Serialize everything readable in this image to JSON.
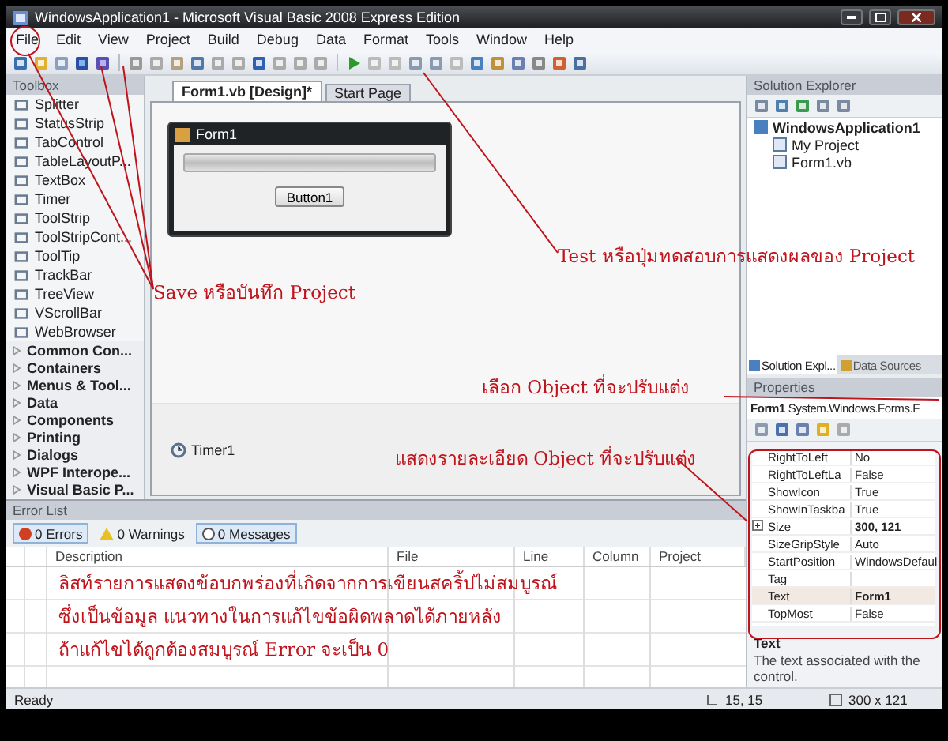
{
  "window": {
    "title": "WindowsApplication1 - Microsoft Visual Basic 2008 Express Edition"
  },
  "menu": [
    "File",
    "Edit",
    "View",
    "Project",
    "Build",
    "Debug",
    "Data",
    "Format",
    "Tools",
    "Window",
    "Help"
  ],
  "toolbox": {
    "title": "Toolbox",
    "items": [
      {
        "label": "Splitter"
      },
      {
        "label": "StatusStrip"
      },
      {
        "label": "TabControl"
      },
      {
        "label": "TableLayoutP..."
      },
      {
        "label": "TextBox"
      },
      {
        "label": "Timer"
      },
      {
        "label": "ToolStrip"
      },
      {
        "label": "ToolStripCont..."
      },
      {
        "label": "ToolTip"
      },
      {
        "label": "TrackBar"
      },
      {
        "label": "TreeView"
      },
      {
        "label": "VScrollBar"
      },
      {
        "label": "WebBrowser"
      }
    ],
    "categories": [
      {
        "label": "Common Con...",
        "expanded": false
      },
      {
        "label": "Containers",
        "expanded": false
      },
      {
        "label": "Menus & Tool...",
        "expanded": false
      },
      {
        "label": "Data",
        "expanded": false
      },
      {
        "label": "Components",
        "expanded": false
      },
      {
        "label": "Printing",
        "expanded": false
      },
      {
        "label": "Dialogs",
        "expanded": false
      },
      {
        "label": "WPF Interope...",
        "expanded": false
      },
      {
        "label": "Visual Basic P...",
        "expanded": false
      }
    ]
  },
  "document_tabs": [
    {
      "label": "Form1.vb [Design]*",
      "selected": true
    },
    {
      "label": "Start Page",
      "selected": false
    }
  ],
  "designer": {
    "form_title": "Form1",
    "progress": {
      "level": 0
    },
    "button": "Button1",
    "component": "Timer1"
  },
  "solution_explorer": {
    "title": "Solution Explorer",
    "tree": [
      {
        "label": "WindowsApplication1",
        "children": [
          {
            "label": "My Project"
          },
          {
            "label": "Form1.vb"
          }
        ]
      }
    ],
    "tabs": [
      {
        "label": "Solution Expl...",
        "selected": true
      },
      {
        "label": "Data Sources",
        "selected": false
      }
    ]
  },
  "properties": {
    "title": "Properties",
    "object": "Form1",
    "type": "System.Windows.Forms.F",
    "rows": [
      {
        "name": "RightToLeft",
        "value": "No",
        "modified": false,
        "selected": false
      },
      {
        "name": "RightToLeftLa",
        "value": "False",
        "modified": false,
        "selected": false
      },
      {
        "name": "ShowIcon",
        "value": "True",
        "modified": false,
        "selected": false
      },
      {
        "name": "ShowInTaskba",
        "value": "True",
        "modified": false,
        "selected": false
      },
      {
        "name": "Size",
        "value": "300, 121",
        "modified": true,
        "selected": false,
        "expandable": true
      },
      {
        "name": "SizeGripStyle",
        "value": "Auto",
        "modified": false,
        "selected": false
      },
      {
        "name": "StartPosition",
        "value": "WindowsDefaul",
        "modified": false,
        "selected": false
      },
      {
        "name": "Tag",
        "selected": false
      },
      {
        "name": "Text",
        "value": "Form1",
        "modified": true,
        "selected": true
      },
      {
        "name": "TopMost",
        "value": "False",
        "modified": false,
        "selected": false
      }
    ],
    "description_title": "Text",
    "description": "The text associated with the control."
  },
  "error_list": {
    "title": "Error List",
    "filters": [
      {
        "label": "0 Errors",
        "kind": "error",
        "selected": true
      },
      {
        "label": "0 Warnings",
        "kind": "warning",
        "selected": false
      },
      {
        "label": "0 Messages",
        "kind": "message",
        "selected": true
      }
    ],
    "columns": [
      "Description",
      "File",
      "Line",
      "Column",
      "Project"
    ]
  },
  "status_bar": {
    "text": "Ready",
    "position": "15, 15",
    "size": "300 x 121"
  },
  "annotations": [
    "Save หรือบันทึก Project",
    "Test หรือปุ่มทดสอบการแสดงผลของ Project",
    "เลือก Object ที่จะปรับแต่ง",
    "แสดงรายละเอียด Object ที่จะปรับแต่ง"
  ],
  "error_notes": [
    "ลิสท์รายการแสดงข้อบกพร่องที่เกิดจากการเขียนสคริ้ปไม่สมบูรณ์",
    "ซึ่งเป็นข้อมูล แนวทางในการแก้ไขข้อผิดพลาดได้ภายหลัง",
    "ถ้าแก้ไขได้ถูกต้องสมบูรณ์ Error จะเป็น 0"
  ]
}
